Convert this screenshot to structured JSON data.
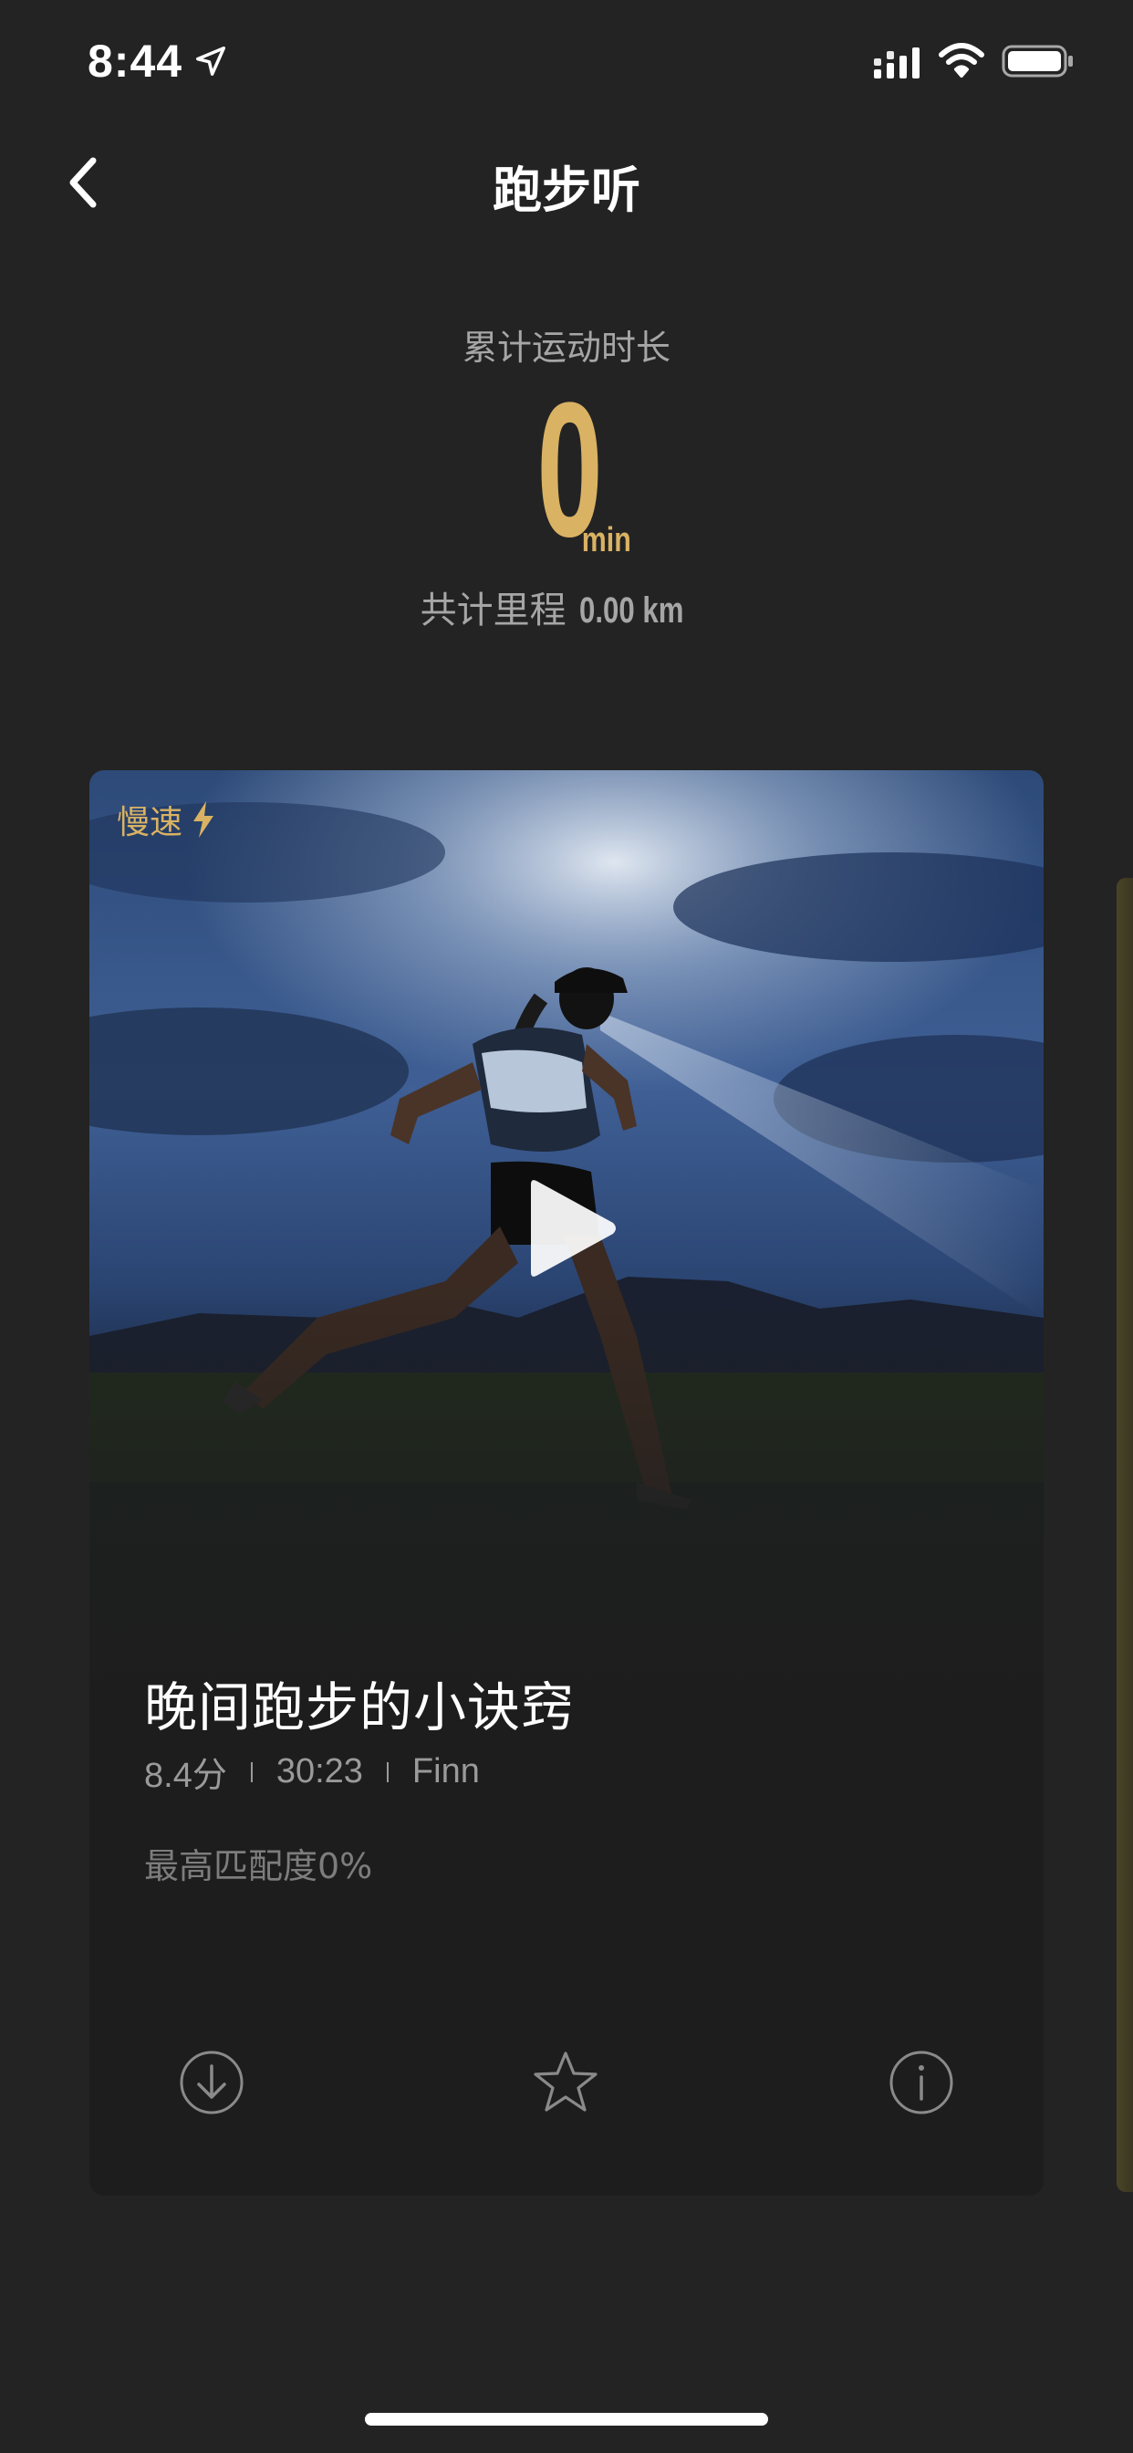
{
  "status_bar": {
    "time": "8:44",
    "icons": [
      "location-arrow-icon",
      "cellular-signal-icon",
      "wifi-icon",
      "battery-icon"
    ]
  },
  "nav": {
    "back_icon": "chevron-left-icon",
    "title": "跑步听"
  },
  "stats": {
    "duration_label": "累计运动时长",
    "duration_value": "0",
    "duration_unit": "min",
    "distance_label": "共计里程",
    "distance_value": "0.00 km"
  },
  "card": {
    "speed_tag": "慢速",
    "speed_icon": "lightning-icon",
    "image": "runner-photo",
    "title": "晚间跑步的小诀窍",
    "score": "8.4分",
    "duration": "30:23",
    "author": "Finn",
    "match": "最高匹配度0%",
    "actions": [
      "download-icon",
      "star-icon",
      "info-icon"
    ]
  },
  "colors": {
    "background": "#232323",
    "card_background": "#1d1d1d",
    "accent_gold": "#d9b263",
    "text_secondary": "#a6a6a6"
  }
}
